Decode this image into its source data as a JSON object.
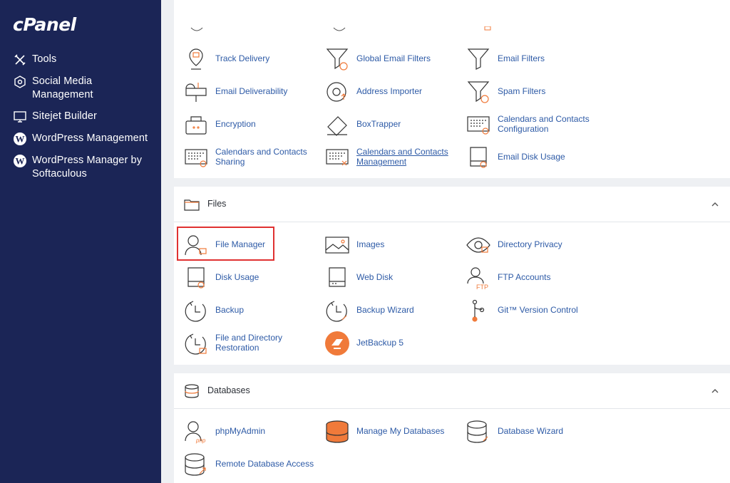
{
  "sidebar": {
    "logo": "cPanel",
    "items": [
      {
        "label": "Tools"
      },
      {
        "label": "Social Media Management"
      },
      {
        "label": "Sitejet Builder"
      },
      {
        "label": "WordPress Management"
      },
      {
        "label": "WordPress Manager by Softaculous"
      }
    ]
  },
  "email": {
    "items": [
      {
        "label": "Track Delivery"
      },
      {
        "label": "Global Email Filters"
      },
      {
        "label": "Email Filters"
      },
      {
        "label": "Email Deliverability"
      },
      {
        "label": "Address Importer"
      },
      {
        "label": "Spam Filters"
      },
      {
        "label": "Encryption"
      },
      {
        "label": "BoxTrapper"
      },
      {
        "label": "Calendars and Contacts Configuration"
      },
      {
        "label": "Calendars and Contacts Sharing"
      },
      {
        "label": "Calendars and Contacts Management"
      },
      {
        "label": "Email Disk Usage"
      }
    ]
  },
  "files": {
    "title": "Files",
    "items": [
      {
        "label": "File Manager"
      },
      {
        "label": "Images"
      },
      {
        "label": "Directory Privacy"
      },
      {
        "label": "Disk Usage"
      },
      {
        "label": "Web Disk"
      },
      {
        "label": "FTP Accounts"
      },
      {
        "label": "Backup"
      },
      {
        "label": "Backup Wizard"
      },
      {
        "label": "Git™ Version Control"
      },
      {
        "label": "File and Directory Restoration"
      },
      {
        "label": "JetBackup 5"
      }
    ]
  },
  "databases": {
    "title": "Databases",
    "items": [
      {
        "label": "phpMyAdmin"
      },
      {
        "label": "Manage My Databases"
      },
      {
        "label": "Database Wizard"
      },
      {
        "label": "Remote Database Access"
      }
    ]
  },
  "colors": {
    "sidebar_bg": "#1b2556",
    "link": "#2d5aa6",
    "accent": "#f07a3a",
    "highlight": "#e03131"
  }
}
